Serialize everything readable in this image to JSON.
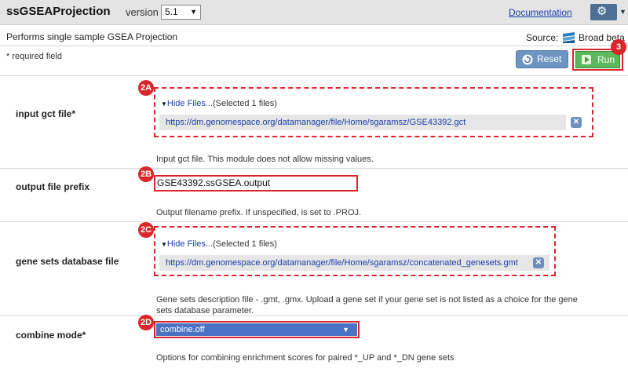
{
  "header": {
    "module_name": "ssGSEAProjection",
    "version_label": "version",
    "version_value": "5.1",
    "version_caret": "▼",
    "documentation_link": "Documentation",
    "gear_glyph": "⚙",
    "gear_caret": "▼"
  },
  "description": "Performs single sample GSEA Projection",
  "source": {
    "label": "Source:",
    "value": "Broad beta",
    "logo_icon": "broad-logo-icon"
  },
  "required_note": "* required field",
  "buttons": {
    "reset": "Reset",
    "run": "Run"
  },
  "callouts": {
    "run": "3",
    "input_gct": "2A",
    "output_prefix": "2B",
    "gene_sets": "2C",
    "combine_mode": "2D"
  },
  "params": {
    "input_gct": {
      "label": "input gct file*",
      "toggle_glyph": "▼",
      "toggle_text": "Hide Files...",
      "selected_text": "(Selected 1 files)",
      "file_url": "https://dm.genomespace.org/datamanager/file/Home/sgaramsz/GSE43392.gct",
      "remove_glyph": "✕",
      "help": "Input gct file. This module does not allow missing values."
    },
    "output_prefix": {
      "label": "output file prefix",
      "value": "GSE43392.ssGSEA.output",
      "help": "Output filename prefix. If unspecified, is set to .PROJ."
    },
    "gene_sets": {
      "label": "gene sets database file",
      "toggle_glyph": "▼",
      "toggle_text": "Hide Files...",
      "selected_text": "(Selected 1 files)",
      "file_url": "https://dm.genomespace.org/datamanager/file/Home/sgaramsz/concatenated_genesets.gmt",
      "remove_glyph": "✕",
      "help": "Gene sets description file - .gmt, .gmx. Upload a gene set if your gene set is not listed as a choice for the gene sets database parameter."
    },
    "combine_mode": {
      "label": "combine mode*",
      "selected": "combine.off",
      "caret": "▼",
      "help": "Options for combining enrichment scores for paired *_UP and *_DN gene sets"
    }
  },
  "colors": {
    "highlight": "#d9262a",
    "link": "#1a3ea8",
    "run_green": "#5cb85c",
    "reset_blue": "#6e94c2",
    "select_blue": "#4a72c4"
  }
}
